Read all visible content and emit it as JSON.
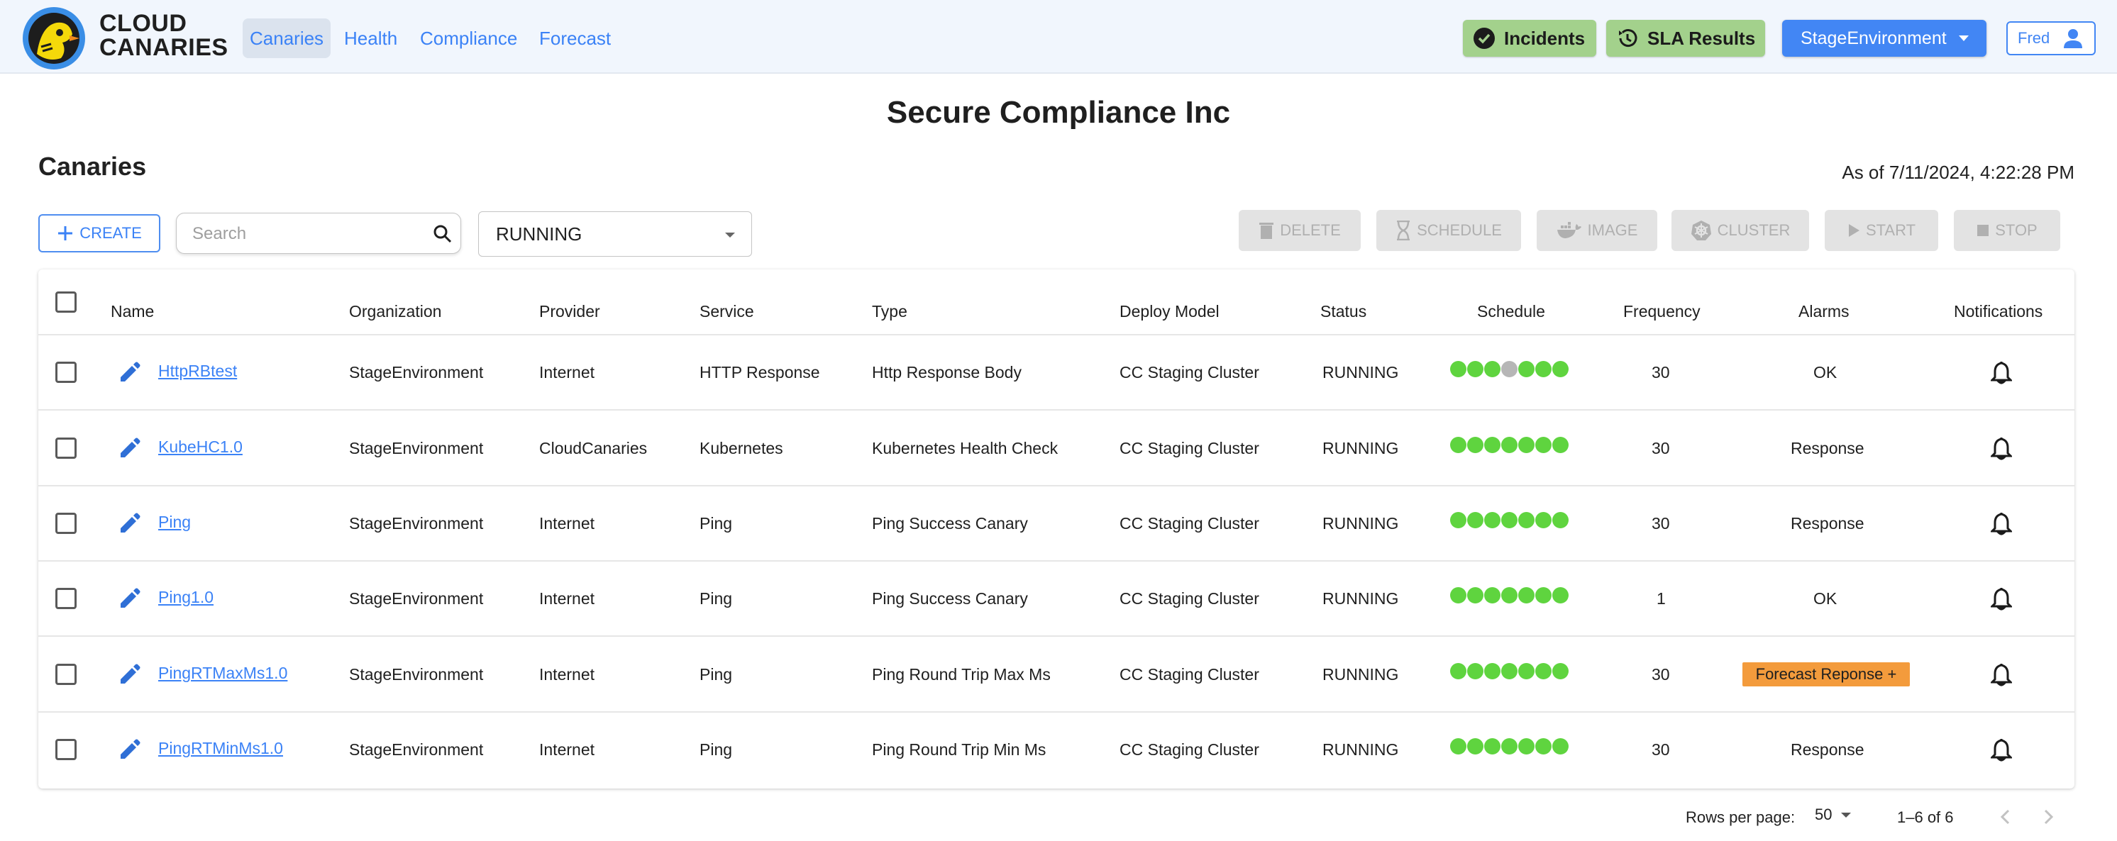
{
  "brand": {
    "line1": "CLOUD",
    "line2": "CANARIES"
  },
  "nav": [
    "Canaries",
    "Health",
    "Compliance",
    "Forecast"
  ],
  "header_buttons": {
    "incidents": "Incidents",
    "sla": "SLA Results",
    "environment": "StageEnvironment",
    "user": "Fred"
  },
  "company": "Secure Compliance Inc",
  "section_title": "Canaries",
  "as_of": "As of 7/11/2024, 4:22:28 PM",
  "toolbar": {
    "create": "CREATE",
    "search_placeholder": "Search",
    "status_filter": "RUNNING",
    "actions": [
      "DELETE",
      "SCHEDULE",
      "IMAGE",
      "CLUSTER",
      "START",
      "STOP"
    ]
  },
  "columns": [
    "Name",
    "Organization",
    "Provider",
    "Service",
    "Type",
    "Deploy Model",
    "Status",
    "Schedule",
    "Frequency",
    "Alarms",
    "Notifications"
  ],
  "rows": [
    {
      "name": "HttpRBtest",
      "organization": "StageEnvironment",
      "provider": "Internet",
      "service": "HTTP Response",
      "type": "Http Response Body",
      "deploy": "CC Staging Cluster",
      "status": "RUNNING",
      "schedule": [
        "on",
        "on",
        "on",
        "off",
        "on",
        "on",
        "on"
      ],
      "frequency": "30",
      "alarms": "OK"
    },
    {
      "name": "KubeHC1.0",
      "organization": "StageEnvironment",
      "provider": "CloudCanaries",
      "service": "Kubernetes",
      "type": "Kubernetes Health Check",
      "deploy": "CC Staging Cluster",
      "status": "RUNNING",
      "schedule": [
        "on",
        "on",
        "on",
        "on",
        "on",
        "on",
        "on"
      ],
      "frequency": "30",
      "alarms": "Response"
    },
    {
      "name": "Ping",
      "organization": "StageEnvironment",
      "provider": "Internet",
      "service": "Ping",
      "type": "Ping Success Canary",
      "deploy": "CC Staging Cluster",
      "status": "RUNNING",
      "schedule": [
        "on",
        "on",
        "on",
        "on",
        "on",
        "on",
        "on"
      ],
      "frequency": "30",
      "alarms": "Response"
    },
    {
      "name": "Ping1.0",
      "organization": "StageEnvironment",
      "provider": "Internet",
      "service": "Ping",
      "type": "Ping Success Canary",
      "deploy": "CC Staging Cluster",
      "status": "RUNNING",
      "schedule": [
        "on",
        "on",
        "on",
        "on",
        "on",
        "on",
        "on"
      ],
      "frequency": "1",
      "alarms": "OK"
    },
    {
      "name": "PingRTMaxMs1.0",
      "organization": "StageEnvironment",
      "provider": "Internet",
      "service": "Ping",
      "type": "Ping Round Trip Max Ms",
      "deploy": "CC Staging Cluster",
      "status": "RUNNING",
      "schedule": [
        "on",
        "on",
        "on",
        "on",
        "on",
        "on",
        "on"
      ],
      "frequency": "30",
      "alarms": "Forecast Reponse +",
      "alarm_highlight": true
    },
    {
      "name": "PingRTMinMs1.0",
      "organization": "StageEnvironment",
      "provider": "Internet",
      "service": "Ping",
      "type": "Ping Round Trip Min Ms",
      "deploy": "CC Staging Cluster",
      "status": "RUNNING",
      "schedule": [
        "on",
        "on",
        "on",
        "on",
        "on",
        "on",
        "on"
      ],
      "frequency": "30",
      "alarms": "Response"
    }
  ],
  "pagination": {
    "rows_label": "Rows per page:",
    "rows_value": "50",
    "range": "1–6 of 6"
  },
  "colors": {
    "accent": "#3b82f6",
    "success_button": "#a3d18c",
    "env_button": "#4286f4",
    "dot_on": "#5fd43f",
    "dot_off": "#b6b6b6",
    "alarm_highlight": "#f39b3c"
  }
}
